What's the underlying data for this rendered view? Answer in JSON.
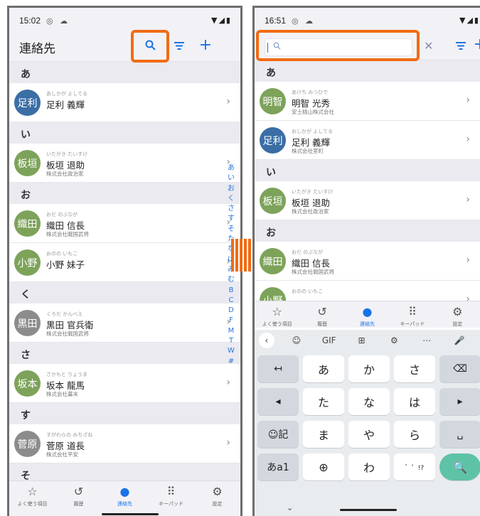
{
  "left_screen": {
    "status": {
      "time": "15:02",
      "notify_icons": "◎ ☁",
      "right_icons": "▼◢▮"
    },
    "header": {
      "title": "連絡先",
      "search_icon": "search-icon",
      "filter_icon": "filter-icon",
      "add_label": "+"
    },
    "sections": [
      {
        "header": "あ",
        "contacts": [
          {
            "avatar": "足利",
            "color": "#3a6ea5",
            "kana": "あしかが よしてる",
            "name": "足利 義輝",
            "company": ""
          }
        ]
      },
      {
        "header": "い",
        "contacts": [
          {
            "avatar": "板垣",
            "color": "#7da35a",
            "kana": "いたがき たいすけ",
            "name": "板垣 退助",
            "company": "株式会社政治家"
          }
        ]
      },
      {
        "header": "お",
        "contacts": [
          {
            "avatar": "織田",
            "color": "#7da35a",
            "kana": "おだ のぶなが",
            "name": "織田 信長",
            "company": "株式会社戦国武将"
          },
          {
            "avatar": "小野",
            "color": "#7da35a",
            "kana": "おのの いもこ",
            "name": "小野 妹子",
            "company": ""
          }
        ]
      },
      {
        "header": "く",
        "contacts": [
          {
            "avatar": "黒田",
            "color": "#8c8c8c",
            "kana": "くろだ かんべえ",
            "name": "黒田 官兵衛",
            "company": "株式会社戦国武将"
          }
        ]
      },
      {
        "header": "さ",
        "contacts": [
          {
            "avatar": "坂本",
            "color": "#7da35a",
            "kana": "さかもと りょうま",
            "name": "坂本 龍馬",
            "company": "株式会社幕末"
          }
        ]
      },
      {
        "header": "す",
        "contacts": [
          {
            "avatar": "菅原",
            "color": "#8c8c8c",
            "kana": "すがわらの みちざね",
            "name": "菅原 道長",
            "company": "株式会社平安"
          }
        ]
      },
      {
        "header": "そ",
        "contacts": []
      }
    ],
    "index": [
      "あ",
      "い",
      "お",
      "く",
      "さ",
      "す",
      "そ",
      "た",
      "な",
      "は",
      "み",
      "む",
      "B",
      "C",
      "D",
      "F",
      "M",
      "T",
      "W",
      "#"
    ]
  },
  "right_screen": {
    "status": {
      "time": "16:51",
      "notify_icons": "◎ ☁",
      "right_icons": "▼◢▮"
    },
    "search": {
      "value": "",
      "placeholder": ""
    },
    "sections": [
      {
        "header": "あ",
        "contacts": [
          {
            "avatar": "明智",
            "color": "#7da35a",
            "kana": "あけち みつひで",
            "name": "明智 光秀",
            "company": "安土桃山株式会社"
          },
          {
            "avatar": "足利",
            "color": "#3a6ea5",
            "kana": "おしかが よしてる",
            "name": "足利 義輝",
            "company": "株式会社室町"
          }
        ]
      },
      {
        "header": "い",
        "contacts": [
          {
            "avatar": "板垣",
            "color": "#7da35a",
            "kana": "いたがき たいすけ",
            "name": "板垣 退助",
            "company": "株式会社政治家"
          }
        ]
      },
      {
        "header": "お",
        "contacts": [
          {
            "avatar": "織田",
            "color": "#7da35a",
            "kana": "おだ のぶなが",
            "name": "織田 信長",
            "company": "株式会社戦国武将"
          },
          {
            "avatar": "小野",
            "color": "#7da35a",
            "kana": "おのの いもこ",
            "name": "",
            "company": ""
          }
        ]
      }
    ],
    "keyboard": {
      "toolbar": [
        "‹",
        "☺",
        "GIF",
        "⊞",
        "⚙",
        "⋯",
        "🎤"
      ],
      "rows": [
        [
          "↤",
          "あ",
          "か",
          "さ",
          "⌫"
        ],
        [
          "◂",
          "た",
          "な",
          "は",
          "▸"
        ],
        [
          "☺記",
          "ま",
          "や",
          "ら",
          "␣"
        ],
        [
          "あa1",
          "⊕",
          "わ",
          "゛゜!?",
          "🔍"
        ]
      ],
      "hide": "⌄"
    }
  },
  "bottom_nav": [
    {
      "icon": "☆",
      "label": "よく使う項目"
    },
    {
      "icon": "↺",
      "label": "履歴"
    },
    {
      "icon": "●",
      "label": "連絡先",
      "active": true
    },
    {
      "icon": "⠿",
      "label": "キーパッド"
    },
    {
      "icon": "⚙",
      "label": "設定"
    }
  ],
  "colors": {
    "accent": "#1a73e8",
    "highlight": "#f26b14"
  }
}
